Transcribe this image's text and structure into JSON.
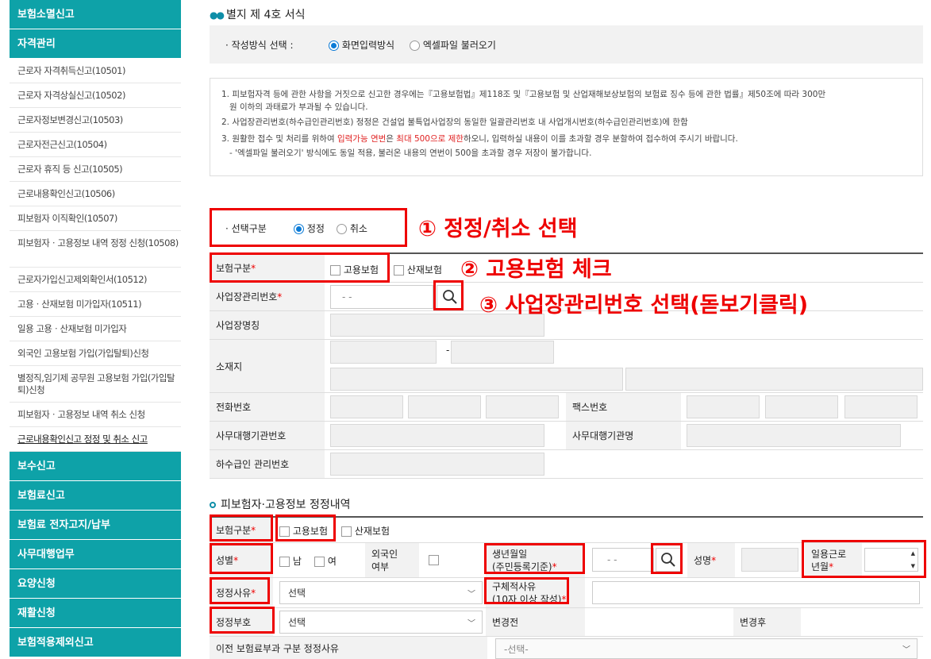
{
  "sidebar": {
    "top": "보험소멸신고",
    "section": "자격관리",
    "items": [
      "근로자 자격취득신고(10501)",
      "근로자 자격상실신고(10502)",
      "근로자정보변경신고(10503)",
      "근로자전근신고(10504)",
      "근로자 휴직 등 신고(10505)",
      "근로내용확인신고(10506)",
      "피보험자 이직확인(10507)",
      "피보험자ㆍ고용정보 내역 정정 신청(10508)",
      "근로자가입신고제외확인서(10512)",
      "고용ㆍ산재보험 미가입자(10511)",
      "일용 고용ㆍ산재보험 미가입자",
      "외국인 고용보험 가입(가입탈퇴)신청",
      "별정직,임기제 공무원 고용보험 가입(가입탈퇴)신청",
      "피보험자ㆍ고용정보 내역 취소 신청",
      "근로내용확인신고 정정 및 취소 신고"
    ],
    "bottom": [
      "보수신고",
      "보험료신고",
      "보험료 전자고지/납부",
      "사무대행업무",
      "요양신청",
      "재활신청",
      "보험적용제외신고"
    ]
  },
  "form": {
    "title": "별지 제 4호 서식",
    "write_mode_label": "작성방식 선택 :",
    "mode_screen": "화면입력방식",
    "mode_excel": "엑셀파일 불러오기",
    "notice": {
      "n1a": "1. 피보험자격 등에 관한 사항을 거짓으로 신고한 경우에는『고용보험법』제118조 및『고용보험 및 산업재해보상보험의 보험료 징수 등에 관한 법률』제50조에 따라 300만",
      "n1b": "원 이하의 과태료가 부과될 수 있습니다.",
      "n2": "2. 사업장관리번호(하수급인관리번호) 정정은 건설업 불특업사업장의 동일한 일괄관리번호 내 사업개시번호(하수급인관리번호)에 한함",
      "n3a": "3. 원활한 접수 및 처리를 위하여 ",
      "n3b": "입력가능 연번",
      "n3c": "은 ",
      "n3d": "최대 500으로 제한",
      "n3e": "하오니, 입력하실 내용이 이를 초과할 경우 분할하여 접수하여 주시기 바랍니다.",
      "n4": "- '엑셀파일 불러오기' 방식에도 동일 적용, 불러온 내용의 연번이 500을 초과할 경우 저장이 불가합니다."
    },
    "select_type_label": "선택구분",
    "opt_correct": "정정",
    "opt_cancel": "취소",
    "ins_type": "보험구분",
    "employ_ins": "고용보험",
    "industrial_ins": "산재보험",
    "biz_no": "사업장관리번호",
    "biz_no_value": "-   -",
    "biz_name": "사업장명칭",
    "address": "소재지",
    "phone": "전화번호",
    "fax": "팩스번호",
    "agency_no": "사무대행기관번호",
    "agency_name": "사무대행기관명",
    "sub_no": "하수급인 관리번호",
    "sec2_title": "피보험자·고용정보 정정내역",
    "gender": "성별",
    "male": "남",
    "female": "여",
    "foreign1": "외국인",
    "foreign2": "여부",
    "birth1": "생년월일",
    "birth2": "(주민등록기준)",
    "birth_value": "-   -",
    "name": "성명",
    "day1": "일용근로",
    "day2": "년월",
    "reason": "정정사유",
    "select": "선택",
    "detail1": "구체적사유",
    "detail2": "(10자 이상 작성)",
    "code": "정정부호",
    "before": "변경전",
    "after": "변경후",
    "prev_reason": "이전 보험료부과 구분 정정사유",
    "prev_select": "-선택-"
  },
  "annotations": {
    "a1": "① 정정/취소 선택",
    "a2": "② 고용보험 체크",
    "a3": "③ 사업장관리번호 선택(돋보기클릭)"
  }
}
